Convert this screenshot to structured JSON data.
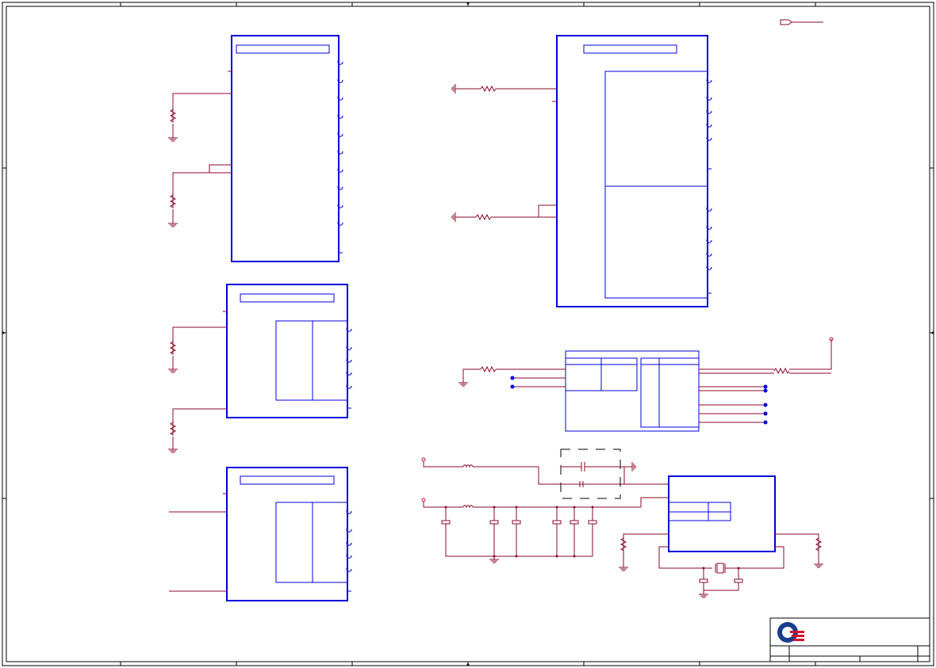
{
  "schematic": {
    "colors": {
      "frame": "#000000",
      "component": "#0000dd",
      "wire": "#8b0a2a",
      "power_port": "#c0103a",
      "logo_blue": "#1a3e8c",
      "logo_red": "#d8102a",
      "background": "#ffffff"
    },
    "frame": {
      "zone_count_horizontal": 8,
      "zone_count_vertical": 4
    },
    "components": [
      {
        "id": "u1",
        "kind": "ic",
        "pins_right": 10
      },
      {
        "id": "u2",
        "kind": "ic",
        "pins_right": 5
      },
      {
        "id": "u3",
        "kind": "ic",
        "pins_right": 5
      },
      {
        "id": "u4",
        "kind": "ic",
        "pins_right": 10
      },
      {
        "id": "u5",
        "kind": "connector"
      },
      {
        "id": "u6",
        "kind": "ic"
      },
      {
        "id": "y1",
        "kind": "crystal"
      }
    ],
    "title_block": {
      "logo": "company-logo"
    }
  }
}
